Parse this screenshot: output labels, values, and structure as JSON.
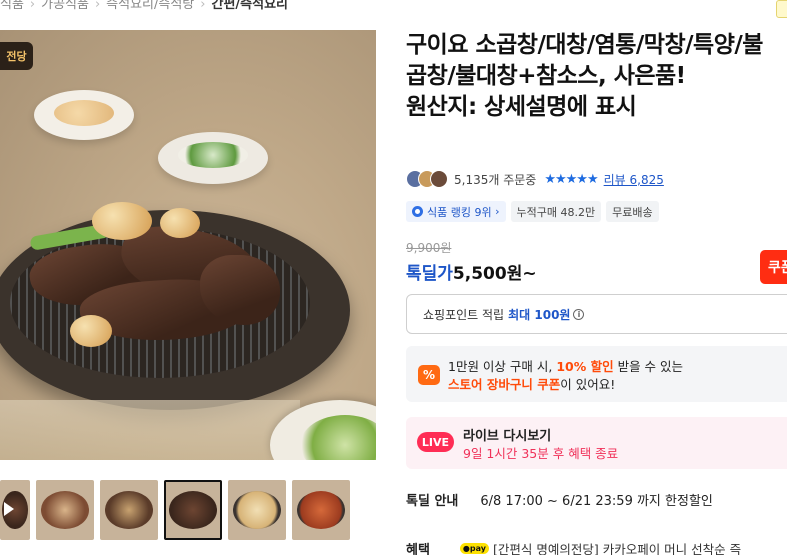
{
  "breadcrumb": [
    "식품",
    "가공식품",
    "즉석요리/즉석탕",
    "간편/즉석요리"
  ],
  "product": {
    "title": "구이요 소곱창/대창/염통/막창/특양/불곱창/불대창+참소스, 사은품!\n원산지: 상세설명에 표시",
    "image_badge": "전당",
    "order_count": "5,135개 주문중",
    "stars": "★★★★★",
    "review_link": "리뷰 6,825",
    "chips": {
      "rank": "식품 랭킹 9위",
      "cumulative": "누적구매 48.2만",
      "shipping": "무료배송"
    },
    "original_price": "9,900원",
    "deal_label": "톡딜가",
    "deal_price": "5,500원~",
    "coupon_button": "쿠폰"
  },
  "point": {
    "label": "쇼핑포인트 적립",
    "value": "최대 100원",
    "info_icon": "i"
  },
  "promo": {
    "icon": "%",
    "line1_pre": "1만원 이상 구매 시, ",
    "line1_hl": "10% 할인",
    "line1_post": " 받을 수 있는",
    "line2_hl": "스토어 장바구니 쿠폰",
    "line2_post": "이 있어요!"
  },
  "live": {
    "badge": "LIVE",
    "title": "라이브 다시보기",
    "subtitle": "9일 1시간 35분 후 혜택 종료"
  },
  "deal_info": {
    "label": "톡딜 안내",
    "value": "6/8 17:00 ~ 6/21 23:59 까지 한정할인"
  },
  "benefit": {
    "label": "혜택",
    "pay_badge": "●pay",
    "text": "[간편식 명예의전당] 카카오페이 머니 선착순 즉"
  },
  "thumbnails": [
    "video",
    "dish-2",
    "dish-3",
    "dish-4",
    "dish-5",
    "dish-6"
  ],
  "colors": {
    "accent_blue": "#1e56c8",
    "coupon_red": "#ff2d12",
    "promo_orange": "#ff6a13",
    "live_pink": "#ff2d55"
  }
}
